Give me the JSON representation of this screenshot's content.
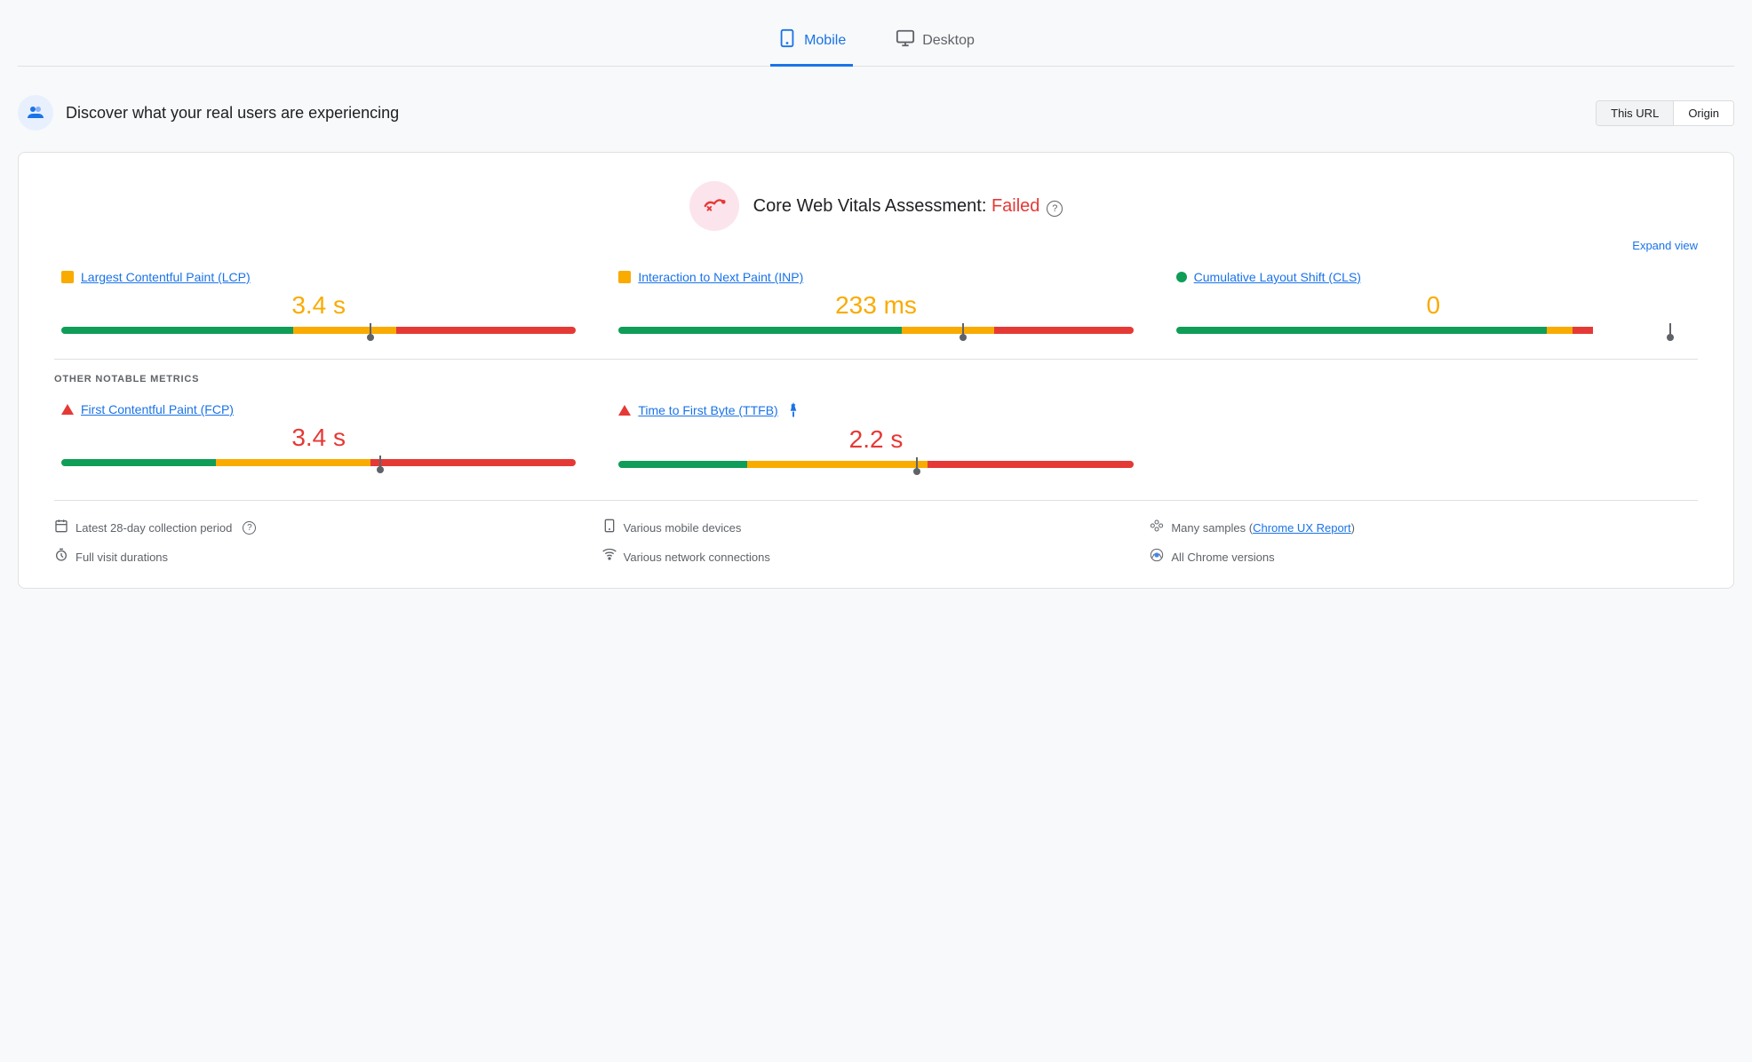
{
  "tabs": [
    {
      "id": "mobile",
      "label": "Mobile",
      "active": true,
      "icon": "📱"
    },
    {
      "id": "desktop",
      "label": "Desktop",
      "active": false,
      "icon": "🖥"
    }
  ],
  "header": {
    "title": "Discover what your real users are experiencing",
    "url_toggle": {
      "this_url_label": "This URL",
      "origin_label": "Origin",
      "active": "this_url"
    }
  },
  "assessment": {
    "title_prefix": "Core Web Vitals Assessment: ",
    "status": "Failed",
    "expand_label": "Expand view"
  },
  "core_metrics": [
    {
      "id": "lcp",
      "label": "Largest Contentful Paint (LCP)",
      "indicator": "square-orange",
      "value": "3.4 s",
      "value_color": "orange",
      "bar": {
        "green": 45,
        "orange": 20,
        "red": 35,
        "marker_pct": 60
      }
    },
    {
      "id": "inp",
      "label": "Interaction to Next Paint (INP)",
      "indicator": "square-orange",
      "value": "233 ms",
      "value_color": "orange",
      "bar": {
        "green": 55,
        "orange": 18,
        "red": 27,
        "marker_pct": 67
      }
    },
    {
      "id": "cls",
      "label": "Cumulative Layout Shift (CLS)",
      "indicator": "circle-green",
      "value": "0",
      "value_color": "orange",
      "bar": {
        "green": 72,
        "orange": 5,
        "red": 4,
        "marker_pct": 96
      }
    }
  ],
  "other_metrics_label": "OTHER NOTABLE METRICS",
  "other_metrics": [
    {
      "id": "fcp",
      "label": "First Contentful Paint (FCP)",
      "indicator": "triangle-red",
      "value": "3.4 s",
      "value_color": "red",
      "bar": {
        "green": 30,
        "orange": 30,
        "red": 40,
        "marker_pct": 62
      }
    },
    {
      "id": "ttfb",
      "label": "Time to First Byte (TTFB)",
      "indicator": "triangle-red",
      "has_info": true,
      "value": "2.2 s",
      "value_color": "red",
      "bar": {
        "green": 25,
        "orange": 35,
        "red": 40,
        "marker_pct": 58
      }
    }
  ],
  "footer": [
    {
      "icon": "📅",
      "text": "Latest 28-day collection period",
      "has_help": true
    },
    {
      "icon": "💻",
      "text": "Various mobile devices"
    },
    {
      "icon": "⚫",
      "text": "Many samples",
      "link_text": "Chrome UX Report",
      "link": true
    },
    {
      "icon": "⏱",
      "text": "Full visit durations"
    },
    {
      "icon": "📶",
      "text": "Various network connections"
    },
    {
      "icon": "🛡",
      "text": "All Chrome versions"
    }
  ]
}
